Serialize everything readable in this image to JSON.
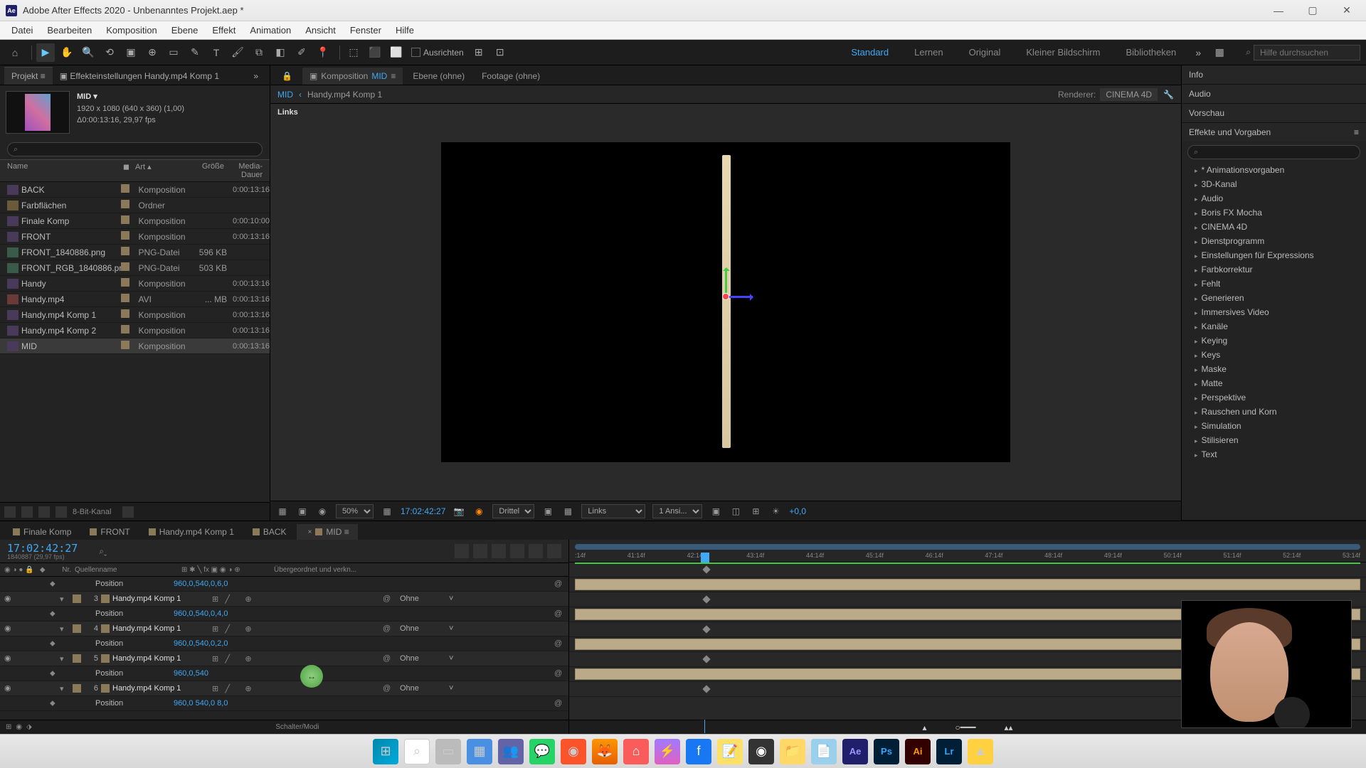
{
  "titlebar": {
    "app_abbr": "Ae",
    "title": "Adobe After Effects 2020 - Unbenanntes Projekt.aep *"
  },
  "menu": {
    "items": [
      "Datei",
      "Bearbeiten",
      "Komposition",
      "Ebene",
      "Effekt",
      "Animation",
      "Ansicht",
      "Fenster",
      "Hilfe"
    ]
  },
  "toolbar": {
    "ausrichten_label": "Ausrichten",
    "workspaces": [
      "Standard",
      "Lernen",
      "Original",
      "Kleiner Bildschirm",
      "Bibliotheken"
    ],
    "search_placeholder": "Hilfe durchsuchen"
  },
  "project_panel": {
    "tab_project": "Projekt",
    "tab_effects": "Effekteinstellungen  Handy.mp4 Komp 1",
    "comp_name": "MID ▾",
    "comp_dims": "1920 x 1080 (640 x 360) (1,00)",
    "comp_dur": "Δ0:00:13:16, 29,97 fps",
    "search_placeholder": "⌕",
    "columns": {
      "name": "Name",
      "art": "Art ▴",
      "größe": "Größe",
      "dauer": "Media-Dauer"
    },
    "items": [
      {
        "name": "BACK",
        "icon": "comp",
        "type": "Komposition",
        "size": "",
        "dur": "0:00:13:16"
      },
      {
        "name": "Farbflächen",
        "icon": "folder",
        "type": "Ordner",
        "size": "",
        "dur": ""
      },
      {
        "name": "Finale Komp",
        "icon": "comp",
        "type": "Komposition",
        "size": "",
        "dur": "0:00:10:00"
      },
      {
        "name": "FRONT",
        "icon": "comp",
        "type": "Komposition",
        "size": "",
        "dur": "0:00:13:16"
      },
      {
        "name": "FRONT_1840886.png",
        "icon": "png",
        "type": "PNG-Datei",
        "size": "596 KB",
        "dur": ""
      },
      {
        "name": "FRONT_RGB_1840886.png",
        "icon": "png",
        "type": "PNG-Datei",
        "size": "503 KB",
        "dur": ""
      },
      {
        "name": "Handy",
        "icon": "comp",
        "type": "Komposition",
        "size": "",
        "dur": "0:00:13:16"
      },
      {
        "name": "Handy.mp4",
        "icon": "avi",
        "type": "AVI",
        "size": "... MB",
        "dur": "0:00:13:16"
      },
      {
        "name": "Handy.mp4 Komp 1",
        "icon": "comp",
        "type": "Komposition",
        "size": "",
        "dur": "0:00:13:16"
      },
      {
        "name": "Handy.mp4 Komp 2",
        "icon": "comp",
        "type": "Komposition",
        "size": "",
        "dur": "0:00:13:16"
      },
      {
        "name": "MID",
        "icon": "comp",
        "type": "Komposition",
        "size": "",
        "dur": "0:00:13:16",
        "selected": true
      }
    ],
    "footer_label": "8-Bit-Kanal"
  },
  "viewer": {
    "tab_comp_prefix": "Komposition",
    "tab_comp_name": "MID",
    "tab_layer": "Ebene  (ohne)",
    "tab_footage": "Footage  (ohne)",
    "bc_current": "MID",
    "bc_parent": "Handy.mp4 Komp 1",
    "renderer_label": "Renderer:",
    "renderer_value": "CINEMA 4D",
    "corner_label": "Links",
    "zoom": "50%",
    "timecode": "17:02:42:27",
    "res_label": "Drittel",
    "view_label": "Links",
    "views_count": "1 Ansi...",
    "exposure": "+0,0"
  },
  "right": {
    "info": "Info",
    "audio": "Audio",
    "vorschau": "Vorschau",
    "effects": "Effekte und Vorgaben",
    "effects_items": [
      "* Animationsvorgaben",
      "3D-Kanal",
      "Audio",
      "Boris FX Mocha",
      "CINEMA 4D",
      "Dienstprogramm",
      "Einstellungen für Expressions",
      "Farbkorrektur",
      "Fehlt",
      "Generieren",
      "Immersives Video",
      "Kanäle",
      "Keying",
      "Keys",
      "Maske",
      "Matte",
      "Perspektive",
      "Rauschen und Korn",
      "Simulation",
      "Stilisieren",
      "Text"
    ]
  },
  "timeline": {
    "tabs": [
      "Finale Komp",
      "FRONT",
      "Handy.mp4 Komp 1",
      "BACK",
      "MID"
    ],
    "timecode": "17:02:42:27",
    "timecode_sub": "1840887 (29,97 fps)",
    "header_nr": "Nr.",
    "header_name": "Quellenname",
    "header_parent": "Übergeordnet und verkn...",
    "position_label": "Position",
    "parent_none": "Ohne",
    "layer_name": "Handy.mp4 Komp 1",
    "layers": [
      {
        "nr": "",
        "name_key": "position_label",
        "val": "960,0,540,0,6,0",
        "is_prop": true
      },
      {
        "nr": "3",
        "name_key": "layer_name",
        "val": "",
        "is_prop": false
      },
      {
        "nr": "",
        "name_key": "position_label",
        "val": "960,0,540,0,4,0",
        "is_prop": true
      },
      {
        "nr": "4",
        "name_key": "layer_name",
        "val": "",
        "is_prop": false
      },
      {
        "nr": "",
        "name_key": "position_label",
        "val": "960,0,540,0,2,0",
        "is_prop": true
      },
      {
        "nr": "5",
        "name_key": "layer_name",
        "val": "",
        "is_prop": false
      },
      {
        "nr": "",
        "name_key": "position_label",
        "val": "960,0,540",
        "is_prop": true
      },
      {
        "nr": "6",
        "name_key": "layer_name",
        "val": "",
        "is_prop": false
      },
      {
        "nr": "",
        "name_key": "position_label",
        "val": "960,0 540,0 8,0",
        "is_prop": true
      }
    ],
    "ruler_ticks": [
      ":14f",
      "41:14f",
      "42:14f",
      "43:14f",
      "44:14f",
      "45:14f",
      "46:14f",
      "47:14f",
      "48:14f",
      "49:14f",
      "50:14f",
      "51:14f",
      "52:14f",
      "53:14f"
    ],
    "footer_label": "Schalter/Modi"
  }
}
